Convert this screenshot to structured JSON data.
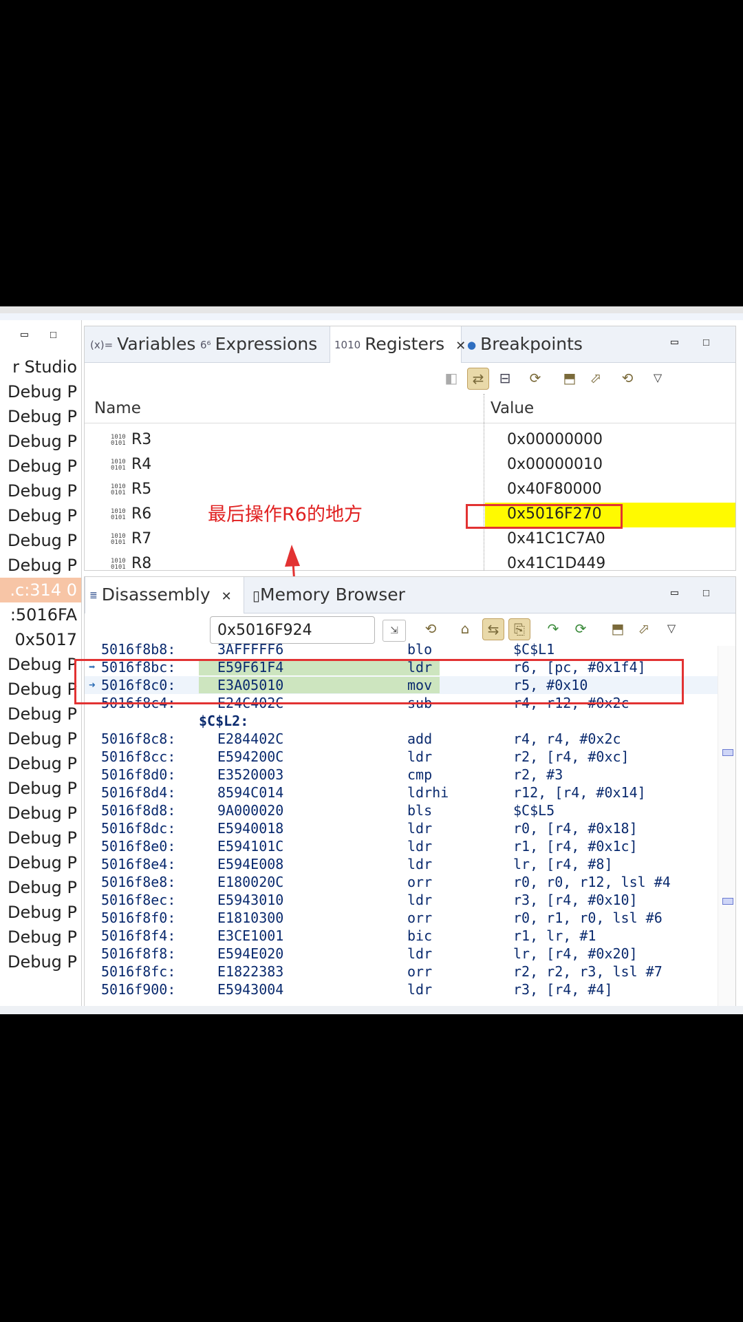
{
  "left_panel": {
    "items": [
      "r Studio",
      "Debug P",
      "Debug P",
      "Debug P",
      "Debug P",
      "Debug P",
      "Debug P",
      "Debug P",
      "Debug P",
      ".c:314 0",
      ":5016FA",
      "0x5017",
      "Debug P",
      "Debug P",
      "Debug P",
      "Debug P",
      "Debug P",
      "Debug P",
      "Debug P",
      "Debug P",
      "Debug P",
      "Debug P",
      "Debug P",
      "Debug P",
      "Debug P"
    ]
  },
  "registers_view": {
    "tabs": [
      {
        "icon": "(x)=",
        "label": "Variables"
      },
      {
        "icon": "6⁶",
        "label": "Expressions"
      },
      {
        "icon": "1010",
        "label": "Registers"
      },
      {
        "icon": "●",
        "label": "Breakpoints"
      }
    ],
    "close_glyph": "✕",
    "columns": {
      "name": "Name",
      "value": "Value"
    },
    "rows": [
      {
        "name": "R3",
        "value": "0x00000000"
      },
      {
        "name": "R4",
        "value": "0x00000010"
      },
      {
        "name": "R5",
        "value": "0x40F80000"
      },
      {
        "name": "R6",
        "value": "0x5016F270"
      },
      {
        "name": "R7",
        "value": "0x41C1C7A0"
      },
      {
        "name": "R8",
        "value": "0x41C1D449"
      }
    ],
    "highlight_color": "#fffa00"
  },
  "annotation": {
    "text": "最后操作R6的地方",
    "color": "#e02020"
  },
  "disassembly_view": {
    "tabs": [
      {
        "label": "Disassembly"
      },
      {
        "label": "Memory Browser"
      }
    ],
    "address_input": "0x5016F924",
    "lines": [
      {
        "addr": "5016f8b8:",
        "hex": "3AFFFFF6",
        "mn": "blo",
        "op": "$C$L1"
      },
      {
        "addr": "5016f8bc:",
        "hex": "E59F61F4",
        "mn": "ldr",
        "op": "r6, [pc, #0x1f4]"
      },
      {
        "addr": "5016f8c0:",
        "hex": "E3A05010",
        "mn": "mov",
        "op": "r5, #0x10"
      },
      {
        "addr": "5016f8c4:",
        "hex": "E24C402C",
        "mn": "sub",
        "op": "r4, r12, #0x2c"
      },
      {
        "label": "$C$L2:"
      },
      {
        "addr": "5016f8c8:",
        "hex": "E284402C",
        "mn": "add",
        "op": "r4, r4, #0x2c"
      },
      {
        "addr": "5016f8cc:",
        "hex": "E594200C",
        "mn": "ldr",
        "op": "r2, [r4, #0xc]"
      },
      {
        "addr": "5016f8d0:",
        "hex": "E3520003",
        "mn": "cmp",
        "op": "r2, #3"
      },
      {
        "addr": "5016f8d4:",
        "hex": "8594C014",
        "mn": "ldrhi",
        "op": "r12, [r4, #0x14]"
      },
      {
        "addr": "5016f8d8:",
        "hex": "9A000020",
        "mn": "bls",
        "op": "$C$L5"
      },
      {
        "addr": "5016f8dc:",
        "hex": "E5940018",
        "mn": "ldr",
        "op": "r0, [r4, #0x18]"
      },
      {
        "addr": "5016f8e0:",
        "hex": "E594101C",
        "mn": "ldr",
        "op": "r1, [r4, #0x1c]"
      },
      {
        "addr": "5016f8e4:",
        "hex": "E594E008",
        "mn": "ldr",
        "op": "lr, [r4, #8]"
      },
      {
        "addr": "5016f8e8:",
        "hex": "E180020C",
        "mn": "orr",
        "op": "r0, r0, r12, lsl #4"
      },
      {
        "addr": "5016f8ec:",
        "hex": "E5943010",
        "mn": "ldr",
        "op": "r3, [r4, #0x10]"
      },
      {
        "addr": "5016f8f0:",
        "hex": "E1810300",
        "mn": "orr",
        "op": "r0, r1, r0, lsl #6"
      },
      {
        "addr": "5016f8f4:",
        "hex": "E3CE1001",
        "mn": "bic",
        "op": "r1, lr, #1"
      },
      {
        "addr": "5016f8f8:",
        "hex": "E594E020",
        "mn": "ldr",
        "op": "lr, [r4, #0x20]"
      },
      {
        "addr": "5016f8fc:",
        "hex": "E1822383",
        "mn": "orr",
        "op": "r2, r2, r3, lsl #7"
      },
      {
        "addr": "5016f900:",
        "hex": "E5943004",
        "mn": "ldr",
        "op": "r3, [r4, #4]"
      }
    ]
  }
}
